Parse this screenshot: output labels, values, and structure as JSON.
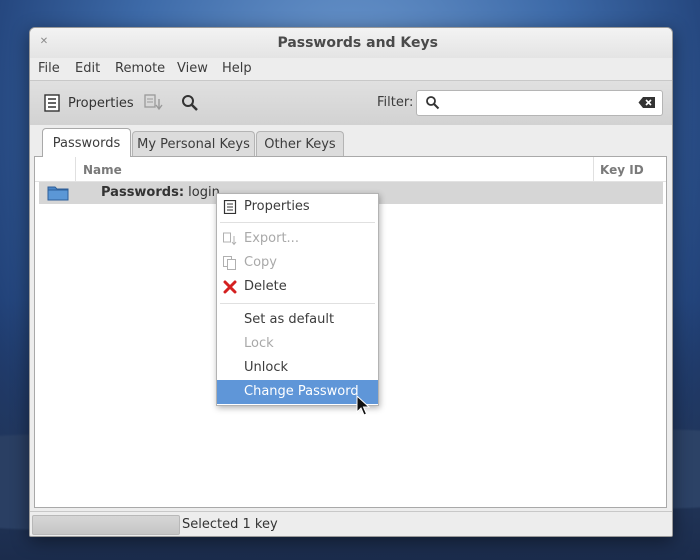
{
  "window": {
    "title": "Passwords and Keys"
  },
  "menubar": {
    "items": [
      "File",
      "Edit",
      "Remote",
      "View",
      "Help"
    ]
  },
  "toolbar": {
    "properties_label": "Properties",
    "filter_label": "Filter:",
    "filter_value": ""
  },
  "tabs": [
    {
      "label": "Passwords",
      "active": true
    },
    {
      "label": "My Personal Keys",
      "active": false
    },
    {
      "label": "Other Keys",
      "active": false
    }
  ],
  "table": {
    "columns": [
      "Name",
      "Key ID"
    ],
    "rows": [
      {
        "name_bold": "Passwords:",
        "name_rest": " login",
        "selected": true
      }
    ]
  },
  "context_menu": {
    "items": [
      {
        "label": "Properties",
        "icon": "properties-icon",
        "enabled": true
      },
      {
        "label": "Export...",
        "icon": "export-icon",
        "enabled": false
      },
      {
        "label": "Copy",
        "icon": "copy-icon",
        "enabled": false
      },
      {
        "label": "Delete",
        "icon": "delete-icon",
        "enabled": true
      },
      {
        "label": "Set as default",
        "enabled": true
      },
      {
        "label": "Lock",
        "enabled": false
      },
      {
        "label": "Unlock",
        "enabled": true
      },
      {
        "label": "Change Password",
        "enabled": true,
        "highlighted": true
      }
    ]
  },
  "status": {
    "text": "Selected 1 key"
  },
  "colors": {
    "highlight": "#5f96d8",
    "delete_red": "#d42020",
    "folder_blue": "#4a86c8"
  }
}
